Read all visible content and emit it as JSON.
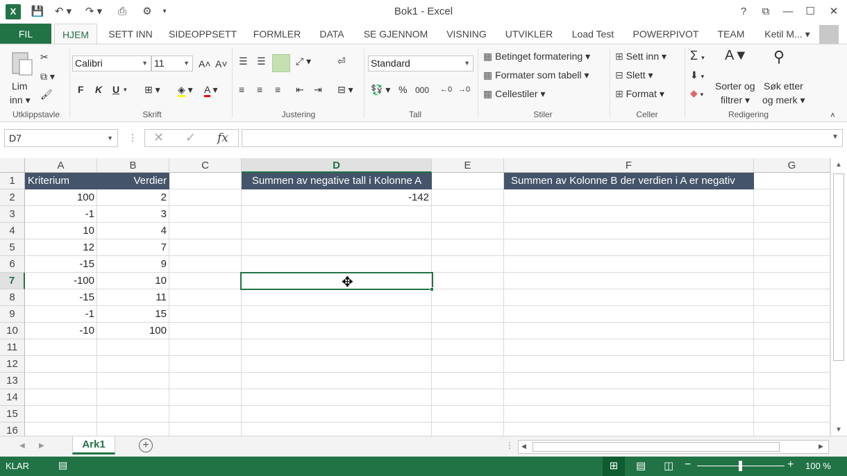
{
  "window": {
    "title": "Bok1 - Excel",
    "help": "?",
    "minimize": "—",
    "maximize": "☐",
    "close": "✕"
  },
  "app_logo": "X",
  "user": "Ketil M...",
  "tabs": [
    {
      "label": "FIL"
    },
    {
      "label": "HJEM"
    },
    {
      "label": "SETT INN"
    },
    {
      "label": "SIDEOPPSETT"
    },
    {
      "label": "FORMLER"
    },
    {
      "label": "DATA"
    },
    {
      "label": "SE GJENNOM"
    },
    {
      "label": "VISNING"
    },
    {
      "label": "UTVIKLER"
    },
    {
      "label": "Load Test"
    },
    {
      "label": "POWERPIVOT"
    },
    {
      "label": "TEAM"
    }
  ],
  "ribbon": {
    "clipboard": {
      "paste": "Lim",
      "paste2": "inn",
      "label": "Utklippstavle"
    },
    "font": {
      "name": "Calibri",
      "size": "11",
      "bold": "F",
      "italic": "K",
      "underline": "U",
      "label": "Skrift"
    },
    "alignment": {
      "label": "Justering"
    },
    "number": {
      "format": "Standard",
      "percent": "%",
      "thousands": "000",
      "label": "Tall"
    },
    "styles": {
      "cond": "Betinget formatering",
      "table": "Formater som tabell",
      "cell": "Cellestiler",
      "label": "Stiler"
    },
    "cells": {
      "insert": "Sett inn",
      "delete": "Slett",
      "format": "Format",
      "label": "Celler"
    },
    "editing": {
      "sort1": "Sorter og",
      "sort2": "filtrer",
      "find1": "Søk etter",
      "find2": "og merk",
      "label": "Redigering"
    }
  },
  "formula_bar": {
    "name_box": "D7",
    "fx": "fx",
    "formula": ""
  },
  "columns": [
    "A",
    "B",
    "C",
    "D",
    "E",
    "F",
    "G"
  ],
  "rows": [
    "1",
    "2",
    "3",
    "4",
    "5",
    "6",
    "7",
    "8",
    "9",
    "10",
    "11",
    "12",
    "13",
    "14",
    "15",
    "16"
  ],
  "cells": {
    "A1": "Kriterium",
    "B1": "Verdier",
    "D1": "Summen av negative tall i Kolonne A",
    "F1": "Summen av Kolonne B der verdien i A er negativ",
    "D2": "-142",
    "A": [
      "100",
      "-1",
      "10",
      "12",
      "-15",
      "-100",
      "-15",
      "-1",
      "-10"
    ],
    "B": [
      "2",
      "3",
      "4",
      "7",
      "9",
      "10",
      "11",
      "15",
      "100"
    ]
  },
  "sheet": {
    "name": "Ark1",
    "add": "+"
  },
  "status": {
    "mode": "KLAR",
    "zoom": "100 %"
  }
}
